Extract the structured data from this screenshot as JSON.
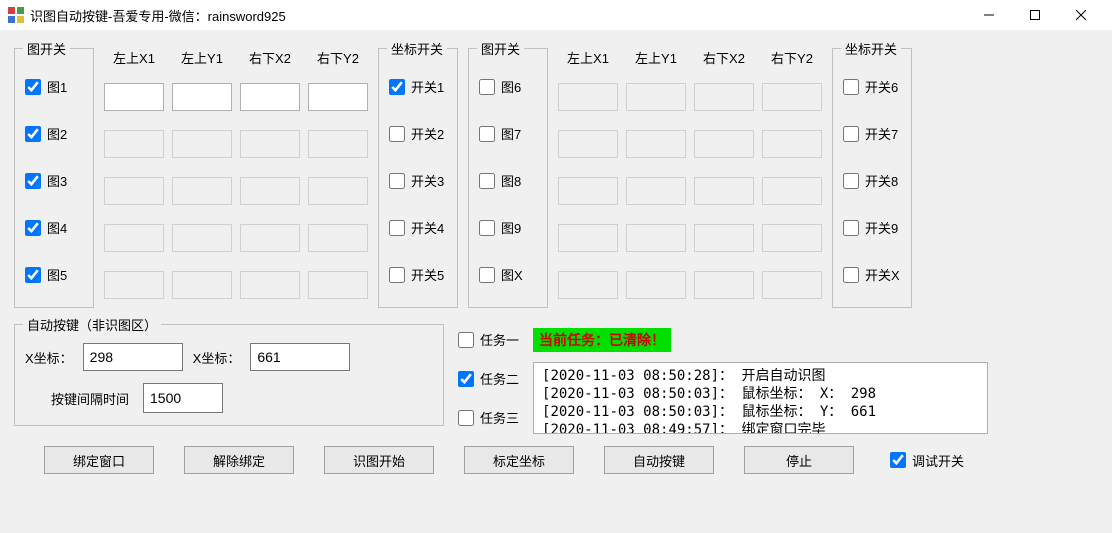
{
  "window": {
    "title": "识图自动按键-吾爱专用-微信：rainsword925"
  },
  "leftPanel": {
    "imgSwitchLegend": "图开关",
    "coordLegend": "",
    "coordHeaders": [
      "左上X1",
      "左上Y1",
      "右下X2",
      "右下Y2"
    ],
    "coordSwitchLegend": "坐标开关",
    "rows": [
      {
        "imgLabel": "图1",
        "imgChecked": true,
        "enabled": true,
        "x1": "",
        "y1": "",
        "x2": "",
        "y2": "",
        "swLabel": "开关1",
        "swChecked": true
      },
      {
        "imgLabel": "图2",
        "imgChecked": true,
        "enabled": false,
        "x1": "",
        "y1": "",
        "x2": "",
        "y2": "",
        "swLabel": "开关2",
        "swChecked": false
      },
      {
        "imgLabel": "图3",
        "imgChecked": true,
        "enabled": false,
        "x1": "",
        "y1": "",
        "x2": "",
        "y2": "",
        "swLabel": "开关3",
        "swChecked": false
      },
      {
        "imgLabel": "图4",
        "imgChecked": true,
        "enabled": false,
        "x1": "",
        "y1": "",
        "x2": "",
        "y2": "",
        "swLabel": "开关4",
        "swChecked": false
      },
      {
        "imgLabel": "图5",
        "imgChecked": true,
        "enabled": false,
        "x1": "",
        "y1": "",
        "x2": "",
        "y2": "",
        "swLabel": "开关5",
        "swChecked": false
      }
    ]
  },
  "rightPanel": {
    "imgSwitchLegend": "图开关",
    "coordHeaders": [
      "左上X1",
      "左上Y1",
      "右下X2",
      "右下Y2"
    ],
    "coordSwitchLegend": "坐标开关",
    "rows": [
      {
        "imgLabel": "图6",
        "imgChecked": false,
        "enabled": false,
        "x1": "",
        "y1": "",
        "x2": "",
        "y2": "",
        "swLabel": "开关6",
        "swChecked": false
      },
      {
        "imgLabel": "图7",
        "imgChecked": false,
        "enabled": false,
        "x1": "",
        "y1": "",
        "x2": "",
        "y2": "",
        "swLabel": "开关7",
        "swChecked": false
      },
      {
        "imgLabel": "图8",
        "imgChecked": false,
        "enabled": false,
        "x1": "",
        "y1": "",
        "x2": "",
        "y2": "",
        "swLabel": "开关8",
        "swChecked": false
      },
      {
        "imgLabel": "图9",
        "imgChecked": false,
        "enabled": false,
        "x1": "",
        "y1": "",
        "x2": "",
        "y2": "",
        "swLabel": "开关9",
        "swChecked": false
      },
      {
        "imgLabel": "图X",
        "imgChecked": false,
        "enabled": false,
        "x1": "",
        "y1": "",
        "x2": "",
        "y2": "",
        "swLabel": "开关X",
        "swChecked": false
      }
    ]
  },
  "autoKey": {
    "legend": "自动按键（非识图区）",
    "xLabel": "X坐标：",
    "xValue": "298",
    "yLabel": "X坐标：",
    "yValue": "661",
    "intervalLabel": "按键间隔时间",
    "intervalValue": "1500"
  },
  "tasks": {
    "t1": {
      "label": "任务一",
      "checked": false
    },
    "t2": {
      "label": "任务二",
      "checked": true
    },
    "t3": {
      "label": "任务三",
      "checked": false
    }
  },
  "status": "当前任务：已清除！",
  "log": [
    "[2020-11-03 08:50:28]： 开启自动识图",
    "[2020-11-03 08:50:03]： 鼠标坐标： X： 298",
    "[2020-11-03 08:50:03]： 鼠标坐标： Y： 661",
    "[2020-11-03 08:49:57]： 绑定窗口完毕"
  ],
  "buttons": {
    "bind": "绑定窗口",
    "unbind": "解除绑定",
    "start": "识图开始",
    "mark": "标定坐标",
    "autokey": "自动按键",
    "stop": "停止",
    "debug": "调试开关"
  }
}
